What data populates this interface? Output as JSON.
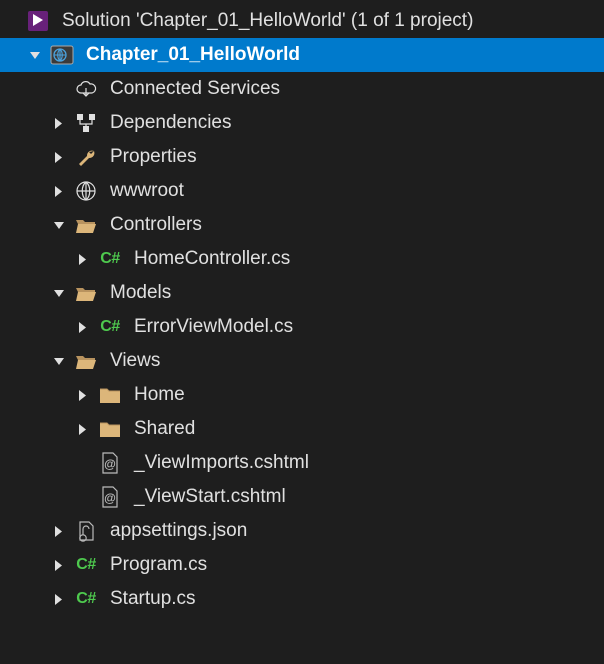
{
  "solution": {
    "label": "Solution 'Chapter_01_HelloWorld' (1 of 1 project)"
  },
  "project": {
    "label": "Chapter_01_HelloWorld"
  },
  "nodes": {
    "connected_services": "Connected Services",
    "dependencies": "Dependencies",
    "properties": "Properties",
    "wwwroot": "wwwroot",
    "controllers": "Controllers",
    "home_controller": "HomeController.cs",
    "models": "Models",
    "error_viewmodel": "ErrorViewModel.cs",
    "views": "Views",
    "home": "Home",
    "shared": "Shared",
    "view_imports": "_ViewImports.cshtml",
    "view_start": "_ViewStart.cshtml",
    "appsettings": "appsettings.json",
    "program": "Program.cs",
    "startup": "Startup.cs"
  },
  "icons": {
    "cs": "C#"
  }
}
